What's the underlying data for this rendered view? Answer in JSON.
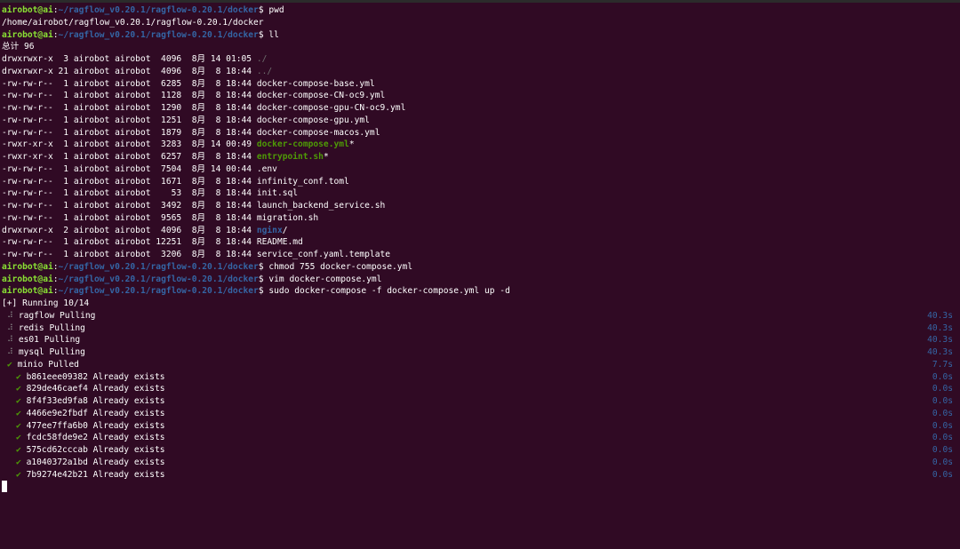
{
  "prompt": {
    "user": "airobot@ai",
    "colon": ":",
    "path": "~/ragflow_v0.20.1/ragflow-0.20.1/docker",
    "symbol": "$ "
  },
  "commands": {
    "pwd": "pwd",
    "ll": "ll",
    "chmod": "chmod 755 docker-compose.yml",
    "vim": "vim docker-compose.yml",
    "up": "sudo docker-compose -f docker-compose.yml up -d"
  },
  "pwd_output": "/home/airobot/ragflow_v0.20.1/ragflow-0.20.1/docker",
  "total_line": "总计 96",
  "listing": [
    {
      "meta": "drwxrwxr-x  3 airobot airobot  4096  8月 14 01:05 ",
      "name": "./",
      "kind": "dim",
      "suffix": ""
    },
    {
      "meta": "drwxrwxr-x 21 airobot airobot  4096  8月  8 18:44 ",
      "name": "../",
      "kind": "dim",
      "suffix": ""
    },
    {
      "meta": "-rw-rw-r--  1 airobot airobot  6285  8月  8 18:44 ",
      "name": "docker-compose-base.yml",
      "kind": "file",
      "suffix": ""
    },
    {
      "meta": "-rw-rw-r--  1 airobot airobot  1128  8月  8 18:44 ",
      "name": "docker-compose-CN-oc9.yml",
      "kind": "file",
      "suffix": ""
    },
    {
      "meta": "-rw-rw-r--  1 airobot airobot  1290  8月  8 18:44 ",
      "name": "docker-compose-gpu-CN-oc9.yml",
      "kind": "file",
      "suffix": ""
    },
    {
      "meta": "-rw-rw-r--  1 airobot airobot  1251  8月  8 18:44 ",
      "name": "docker-compose-gpu.yml",
      "kind": "file",
      "suffix": ""
    },
    {
      "meta": "-rw-rw-r--  1 airobot airobot  1879  8月  8 18:44 ",
      "name": "docker-compose-macos.yml",
      "kind": "file",
      "suffix": ""
    },
    {
      "meta": "-rwxr-xr-x  1 airobot airobot  3283  8月 14 00:49 ",
      "name": "docker-compose.yml",
      "kind": "exec",
      "suffix": "*"
    },
    {
      "meta": "-rwxr-xr-x  1 airobot airobot  6257  8月  8 18:44 ",
      "name": "entrypoint.sh",
      "kind": "exec",
      "suffix": "*"
    },
    {
      "meta": "-rw-rw-r--  1 airobot airobot  7504  8月 14 00:44 ",
      "name": ".env",
      "kind": "file",
      "suffix": ""
    },
    {
      "meta": "-rw-rw-r--  1 airobot airobot  1671  8月  8 18:44 ",
      "name": "infinity_conf.toml",
      "kind": "file",
      "suffix": ""
    },
    {
      "meta": "-rw-rw-r--  1 airobot airobot    53  8月  8 18:44 ",
      "name": "init.sql",
      "kind": "file",
      "suffix": ""
    },
    {
      "meta": "-rw-rw-r--  1 airobot airobot  3492  8月  8 18:44 ",
      "name": "launch_backend_service.sh",
      "kind": "file",
      "suffix": ""
    },
    {
      "meta": "-rw-rw-r--  1 airobot airobot  9565  8月  8 18:44 ",
      "name": "migration.sh",
      "kind": "file",
      "suffix": ""
    },
    {
      "meta": "drwxrwxr-x  2 airobot airobot  4096  8月  8 18:44 ",
      "name": "nginx",
      "kind": "dir",
      "suffix": "/"
    },
    {
      "meta": "-rw-rw-r--  1 airobot airobot 12251  8月  8 18:44 ",
      "name": "README.md",
      "kind": "file",
      "suffix": ""
    },
    {
      "meta": "-rw-rw-r--  1 airobot airobot  3206  8月  8 18:44 ",
      "name": "service_conf.yaml.template",
      "kind": "file",
      "suffix": ""
    }
  ],
  "compose": {
    "running": "[+] Running 10/14",
    "services": [
      {
        "icon": "⠼",
        "status": "spinner",
        "text": "ragflow Pulling",
        "time": "40.3s"
      },
      {
        "icon": "⠼",
        "status": "spinner",
        "text": "redis Pulling",
        "time": "40.3s"
      },
      {
        "icon": "⠼",
        "status": "spinner",
        "text": "es01 Pulling",
        "time": "40.3s"
      },
      {
        "icon": "⠼",
        "status": "spinner",
        "text": "mysql Pulling",
        "time": "40.3s"
      },
      {
        "icon": "✔",
        "status": "done",
        "text": "minio Pulled",
        "time": "7.7s"
      }
    ],
    "layers": [
      {
        "icon": "✔",
        "text": "b861eee09382 Already exists",
        "time": "0.0s"
      },
      {
        "icon": "✔",
        "text": "829de46caef4 Already exists",
        "time": "0.0s"
      },
      {
        "icon": "✔",
        "text": "8f4f33ed9fa8 Already exists",
        "time": "0.0s"
      },
      {
        "icon": "✔",
        "text": "4466e9e2fbdf Already exists",
        "time": "0.0s"
      },
      {
        "icon": "✔",
        "text": "477ee7ffa6b0 Already exists",
        "time": "0.0s"
      },
      {
        "icon": "✔",
        "text": "fcdc58fde9e2 Already exists",
        "time": "0.0s"
      },
      {
        "icon": "✔",
        "text": "575cd62cccab Already exists",
        "time": "0.0s"
      },
      {
        "icon": "✔",
        "text": "a1040372a1bd Already exists",
        "time": "0.0s"
      },
      {
        "icon": "✔",
        "text": "7b9274e42b21 Already exists",
        "time": "0.0s"
      }
    ]
  },
  "colors": {
    "background": "#300a24",
    "prompt_user": "#8ae234",
    "prompt_path": "#3465a4",
    "directory": "#3465a4",
    "executable": "#4e9a06",
    "check": "#4e9a06",
    "timer": "#3465a4"
  }
}
